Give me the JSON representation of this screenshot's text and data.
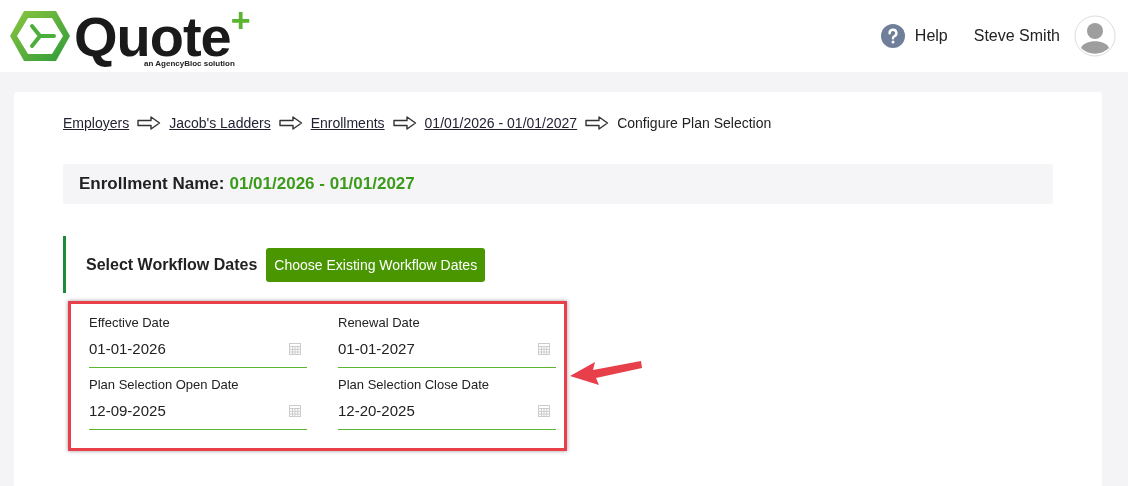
{
  "header": {
    "logo": {
      "name": "Quote",
      "mark": "+",
      "tagline": "an AgencyBloc solution"
    },
    "help": "Help",
    "user": "Steve Smith"
  },
  "breadcrumb": [
    {
      "label": "Employers",
      "link": true
    },
    {
      "label": "Jacob's Ladders",
      "link": true
    },
    {
      "label": "Enrollments",
      "link": true
    },
    {
      "label": "01/01/2026 - 01/01/2027",
      "link": true
    },
    {
      "label": "Configure Plan Selection",
      "link": false
    }
  ],
  "enrollment": {
    "label": "Enrollment Name:",
    "value": "01/01/2026 - 01/01/2027"
  },
  "workflow": {
    "title": "Select Workflow Dates",
    "button": "Choose Existing Workflow Dates"
  },
  "fields": [
    {
      "label": "Effective Date",
      "value": "01-01-2026"
    },
    {
      "label": "Renewal Date",
      "value": "01-01-2027"
    },
    {
      "label": "Plan Selection Open Date",
      "value": "12-09-2025"
    },
    {
      "label": "Plan Selection Close Date",
      "value": "12-20-2025"
    }
  ]
}
